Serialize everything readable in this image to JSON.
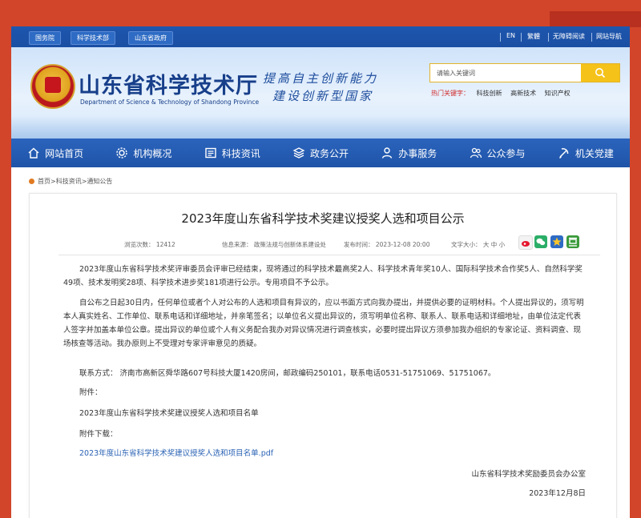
{
  "topbar": {
    "left_links": [
      "国务院",
      "科学技术部",
      "山东省政府"
    ],
    "right_links": [
      "EN",
      "繁體",
      "无障碍阅读",
      "网站导航"
    ]
  },
  "header": {
    "title": "山东省科学技术厅",
    "subtitle": "Department of Science & Technology of Shandong Province",
    "slogan_line1": "提高自主创新能力",
    "slogan_line2": "建设创新型国家",
    "search_placeholder": "请输入关键词",
    "hot_label": "热门关键字：",
    "hot_items": [
      "科技创新",
      "高新技术",
      "知识产权"
    ]
  },
  "nav": {
    "items": [
      {
        "label": "网站首页",
        "icon": "home-icon"
      },
      {
        "label": "机构概况",
        "icon": "gear-icon"
      },
      {
        "label": "科技资讯",
        "icon": "news-icon"
      },
      {
        "label": "政务公开",
        "icon": "layers-icon"
      },
      {
        "label": "办事服务",
        "icon": "user-icon"
      },
      {
        "label": "公众参与",
        "icon": "people-icon"
      },
      {
        "label": "机关党建",
        "icon": "party-icon"
      }
    ]
  },
  "breadcrumb": "首页>科技资讯>通知公告",
  "article": {
    "title": "2023年度山东省科学技术奖建议授奖人选和项目公示",
    "views": "浏览次数：  12412",
    "source": "信息来源：  政策法规与创新体系建设处",
    "date": "发布时间：  2023-12-08 20:00",
    "font_size": "文字大小：  大  中  小",
    "p1": "2023年度山东省科学技术奖评审委员会评审已经结束，现将通过的科学技术最高奖2人、科学技术青年奖10人、国际科学技术合作奖5人、自然科学奖49项、技术发明奖28项、科学技术进步奖181项进行公示。专用项目不予公示。",
    "p2": "自公布之日起30日内，任何单位或者个人对公布的人选和项目有异议的，应以书面方式向我办提出，并提供必要的证明材料。个人提出异议的，须写明本人真实姓名、工作单位、联系电话和详细地址，并亲笔签名；以单位名义提出异议的，须写明单位名称、联系人、联系电话和详细地址，由单位法定代表人签字并加盖本单位公章。提出异议的单位或个人有义务配合我办对异议情况进行调查核实，必要时提出异议方须参加我办组织的专家论证、资料调查、现场核查等活动。我办原则上不受理对专家评审意见的质疑。",
    "contact": "联系方式：  济南市高新区舜华路607号科技大厦1420房间，邮政编码250101，联系电话0531-51751069、51751067。",
    "attach_label": "附件：",
    "attach_name": "2023年度山东省科学技术奖建议授奖人选和项目名单",
    "download_label": "附件下载：",
    "download_link": "2023年度山东省科学技术奖建议授奖人选和项目名单.pdf",
    "signature": "山东省科学技术奖励委员会办公室",
    "sign_date": "2023年12月8日"
  },
  "colors": {
    "page_frame": "#d2452a",
    "topbar_blue": "#1e56ae",
    "nav_blue": "#2257aa",
    "search_yellow": "#f5c21a",
    "hot_red": "#d12b2b",
    "link_blue": "#2b63b5"
  }
}
